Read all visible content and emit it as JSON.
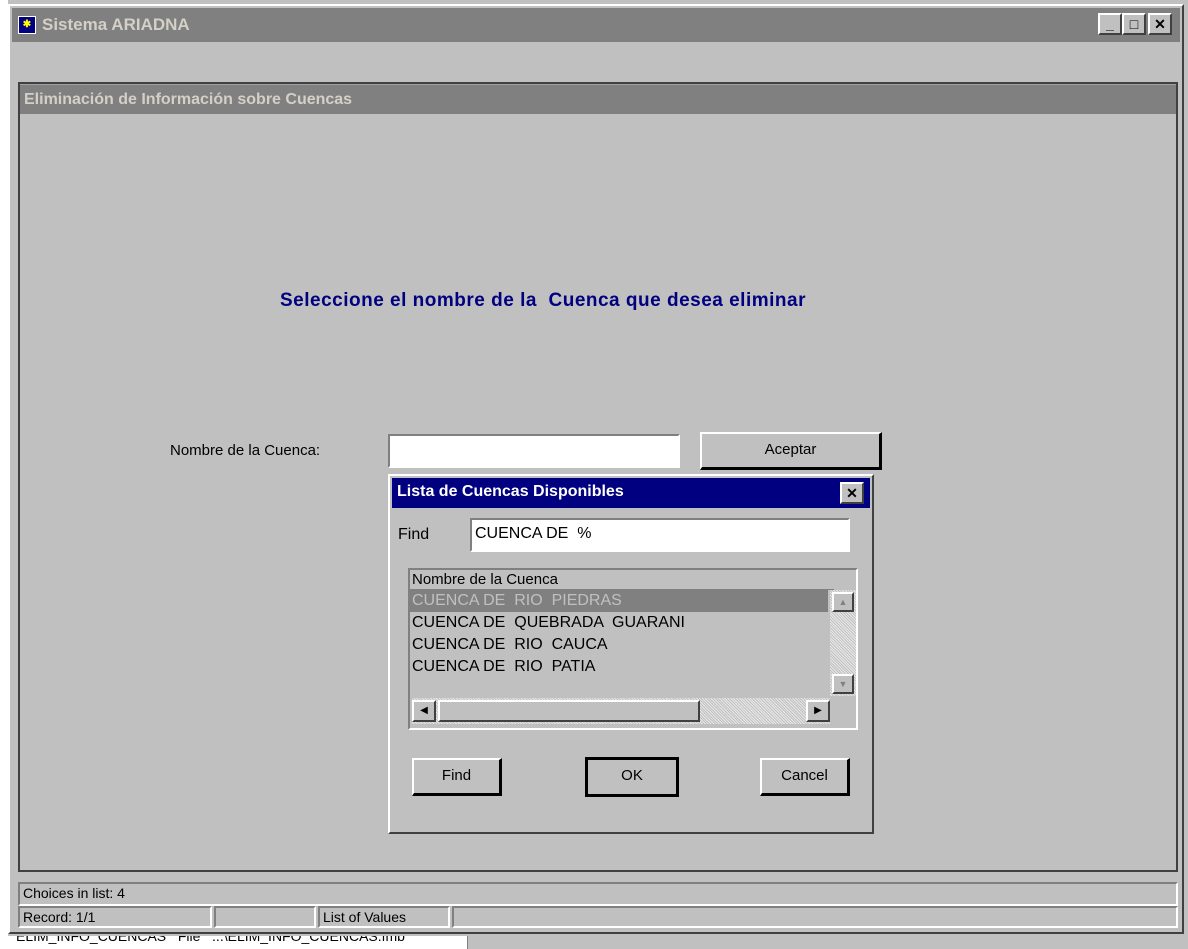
{
  "window": {
    "title": "Sistema ARIADNA"
  },
  "form": {
    "title": "Eliminación de Información sobre Cuencas",
    "heading": "Seleccione el nombre de la  Cuenca que desea eliminar",
    "field_label": "Nombre de la Cuenca:",
    "field_value": "",
    "accept_label": "Aceptar"
  },
  "lov": {
    "title": "Lista de Cuencas Disponibles",
    "find_label": "Find",
    "find_value": "CUENCA DE  %",
    "column_header": "Nombre de la Cuenca",
    "rows": [
      "CUENCA DE  RIO  PIEDRAS",
      "CUENCA DE  QUEBRADA  GUARANI",
      "CUENCA DE  RIO  CAUCA",
      "CUENCA DE  RIO  PATIA"
    ],
    "find_button": "Find",
    "ok_button": "OK",
    "cancel_button": "Cancel"
  },
  "status": {
    "message": "Choices in list: 4",
    "record": "Record: 1/1",
    "cell2": "",
    "mode": "List of Values",
    "bottom_text": "ELIM_INFO_CUENCAS   File   ...\\ELIM_INFO_CUENCAS.fmb"
  },
  "colors": {
    "title_bar_inactive": "#808080",
    "dialog_title": "#000080",
    "heading_text": "#000080",
    "selected_row": "#808080"
  }
}
